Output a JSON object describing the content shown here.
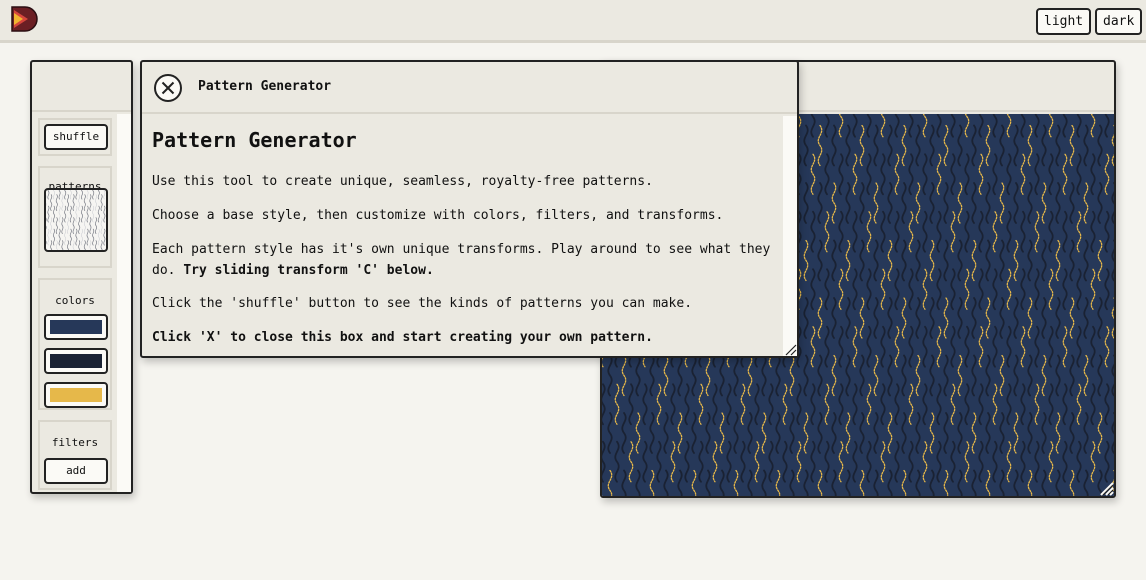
{
  "header": {
    "logo": "app-logo",
    "theme_buttons": [
      "light",
      "dark"
    ]
  },
  "tools": {
    "shuffle_label": "shuffle",
    "patterns_label": "patterns",
    "colors_label": "colors",
    "colors": [
      "#263859",
      "#1a2233",
      "#e6b84a"
    ],
    "filters_label": "filters",
    "add_label": "add"
  },
  "dialog": {
    "header_title": "Pattern Generator",
    "heading": "Pattern Generator",
    "p1": "Use this tool to create unique, seamless, royalty-free patterns.",
    "p2": "Choose a base style, then customize with colors, filters, and transforms.",
    "p3_plain": "Each pattern style has it's own unique transforms. Play around to see what they do. ",
    "p3_bold": "Try sliding transform 'C' below.",
    "p4": "Click the 'shuffle' button to see the kinds of patterns you can make.",
    "p5": "Click 'X' to close this box and start creating your own pattern."
  },
  "preview": {
    "background": "#263859",
    "wave_dark": "#1a2233",
    "wave_light": "#e6b84a"
  }
}
